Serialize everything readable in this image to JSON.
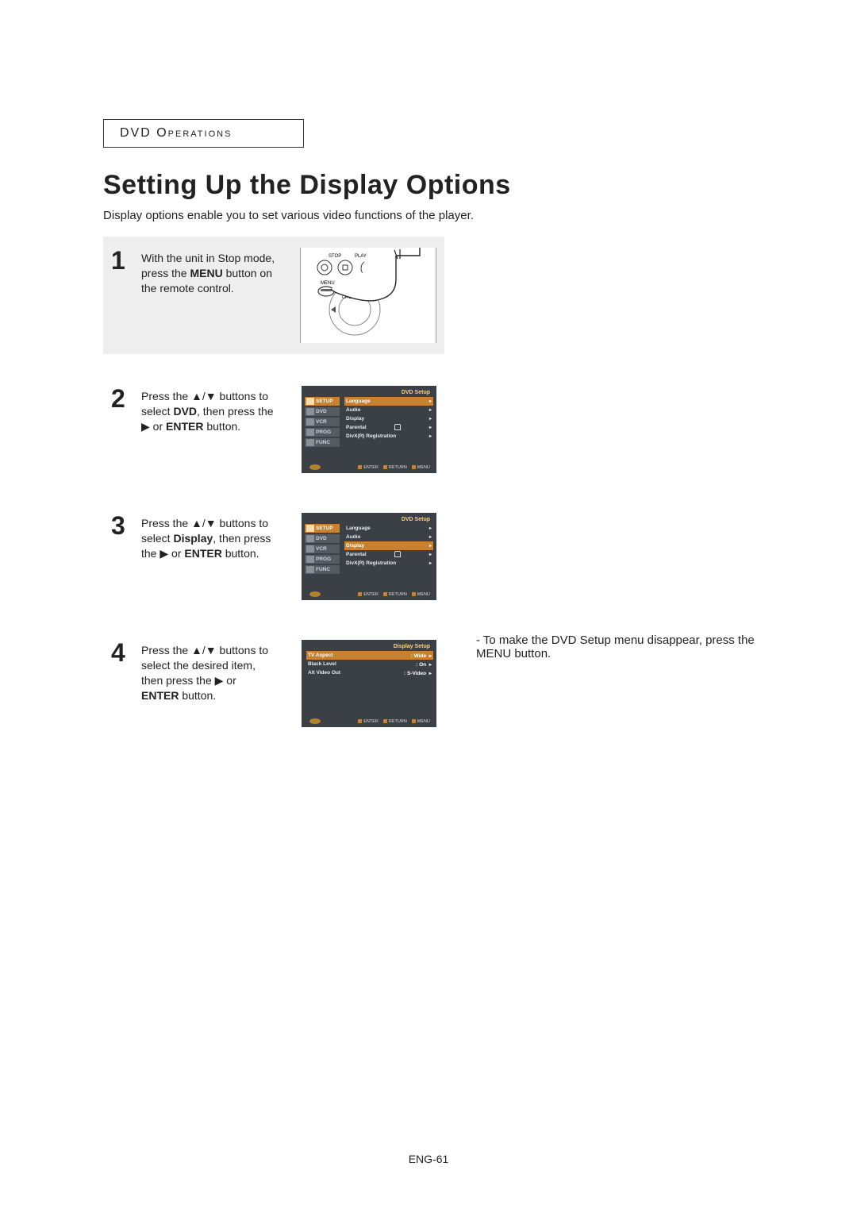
{
  "section_tag": "DVD Operations",
  "title": "Setting Up the Display Options",
  "intro": "Display options enable you to set various video functions of the player.",
  "steps": {
    "s1": {
      "num": "1",
      "text_pre": "With the unit in Stop mode, press the ",
      "text_bold1": "MENU",
      "text_post": " button on the remote control.",
      "remote": {
        "stop": "STOP",
        "play": "PLAY",
        "menu": "MENU",
        "ch_trk": "CH/TRK"
      }
    },
    "s2": {
      "num": "2",
      "text_a": "Press the ",
      "text_b": " buttons to select ",
      "bold": "DVD",
      "text_c": ", then press the ",
      "text_d": " or ",
      "bold2": "ENTER",
      "text_e": " button."
    },
    "s3": {
      "num": "3",
      "text_a": "Press the ",
      "text_b": " buttons to select ",
      "bold": "Display",
      "text_c": ", then press the ",
      "text_d": " or ",
      "bold2": "ENTER",
      "text_e": " button."
    },
    "s4": {
      "num": "4",
      "text_a": "Press the ",
      "text_b": " buttons to select the desired item, then press the ",
      "text_d": " or ",
      "bold2": "ENTER",
      "text_e": " button."
    }
  },
  "osd_dvd": {
    "title": "DVD Setup",
    "tabs": [
      "SETUP",
      "DVD",
      "VCR",
      "PROG",
      "FUNC"
    ],
    "items": [
      "Language",
      "Audio",
      "Display",
      "Parental",
      "DivX(R) Registration"
    ],
    "footer": [
      "ENTER",
      "RETURN",
      "MENU"
    ]
  },
  "osd_display": {
    "title": "Display Setup",
    "rows": [
      {
        "label": "TV Aspect",
        "value": "Wide"
      },
      {
        "label": "Black Level",
        "value": "On"
      },
      {
        "label": "Alt Video Out",
        "value": "S-Video"
      }
    ],
    "footer": [
      "ENTER",
      "RETURN",
      "MENU"
    ]
  },
  "note": "To make the DVD Setup menu disappear, press the MENU button.",
  "page_number": "ENG-61",
  "glyphs": {
    "up": "▲",
    "down": "▼",
    "right": "▶",
    "slash": "/"
  }
}
